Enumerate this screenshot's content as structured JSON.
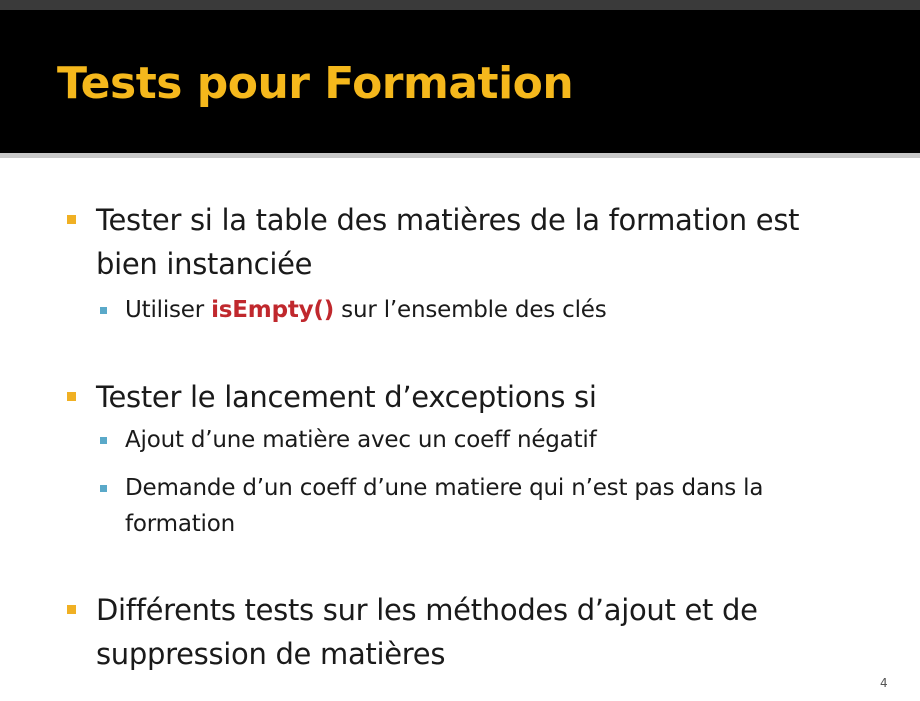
{
  "slide": {
    "title": "Tests pour Formation",
    "page_number": "4",
    "colors": {
      "title_band": "#000000",
      "title_text": "#f5b81c",
      "bullet_level1": "#f0b023",
      "bullet_level2": "#5aa9c9",
      "code_highlight": "#c0282d"
    },
    "items": [
      {
        "text_line1": "Tester si la table des matières de la formation est",
        "text_line2": "bien instanciée",
        "sub": [
          {
            "prefix": "Utiliser ",
            "code": "isEmpty()",
            "suffix": " sur l’ensemble des clés"
          }
        ]
      },
      {
        "text": "Tester le lancement  d’exceptions si",
        "sub": [
          {
            "text": "Ajout d’une matière avec un coeff négatif"
          },
          {
            "text_line1": "Demande d’un coeff d’une matiere qui n’est pas dans la",
            "text_line2": "formation"
          }
        ]
      },
      {
        "text_line1": "Différents tests sur les méthodes d’ajout et de",
        "text_line2": "suppression de matières"
      }
    ]
  }
}
